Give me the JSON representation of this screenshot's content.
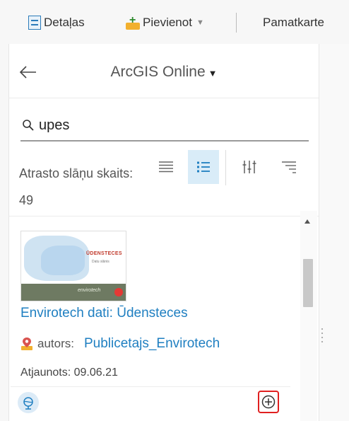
{
  "toolbar": {
    "details_label": "Detaļas",
    "add_label": "Pievienot",
    "basemap_label": "Pamatkarte"
  },
  "panel": {
    "source_label": "ArcGIS Online",
    "search": {
      "value": "upes"
    },
    "count_text": "Atrasto slāņu skaits: 49"
  },
  "result": {
    "thumbnail": {
      "title": "ŪDENSTECES",
      "subtitle": "Datu slānis",
      "logo": "envirotech"
    },
    "title": "Envirotech dati: Ūdensteces",
    "author_label": "autors:",
    "author_name": "Publicetajs_Envirotech",
    "updated": "Atjaunots: 09.06.21"
  },
  "colors": {
    "link": "#1f7fc1",
    "active_view_bg": "#d9ecf8",
    "highlight_border": "#e02020"
  },
  "icons": [
    "details-icon",
    "add-icon",
    "basemap-icon",
    "back-arrow-icon",
    "search-icon",
    "list-compact-icon",
    "list-detailed-icon",
    "filter-icon",
    "sort-icon",
    "pin-icon",
    "globe-icon",
    "add-circle-icon"
  ]
}
